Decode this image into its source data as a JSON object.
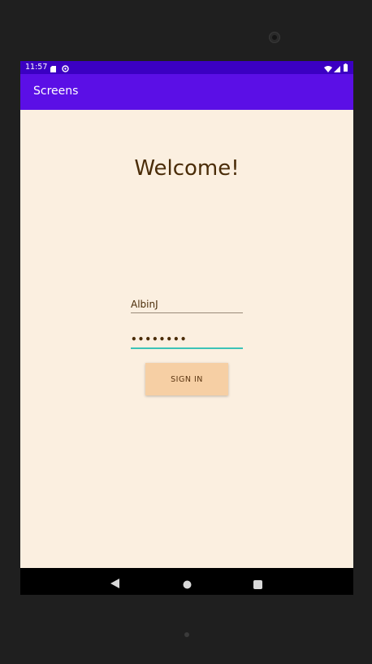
{
  "status_bar": {
    "time": "11:57",
    "left_icons": [
      "sd-card-icon",
      "sync-icon"
    ],
    "right_icons": [
      "wifi-icon",
      "signal-icon",
      "battery-icon"
    ]
  },
  "app_bar": {
    "title": "Screens"
  },
  "main": {
    "welcome": "Welcome!",
    "username_value": "AlbinJ",
    "password_value": "••••••••",
    "signin_label": "SIGN IN"
  },
  "nav_bar": {
    "buttons": [
      "back-icon",
      "home-icon",
      "recents-icon"
    ]
  },
  "colors": {
    "status_bar": "#3b00c2",
    "app_bar": "#5b0fe6",
    "background": "#fbefe0",
    "button": "#f6cfa4",
    "accent": "#3cc3b7",
    "text": "#4a2c08"
  }
}
